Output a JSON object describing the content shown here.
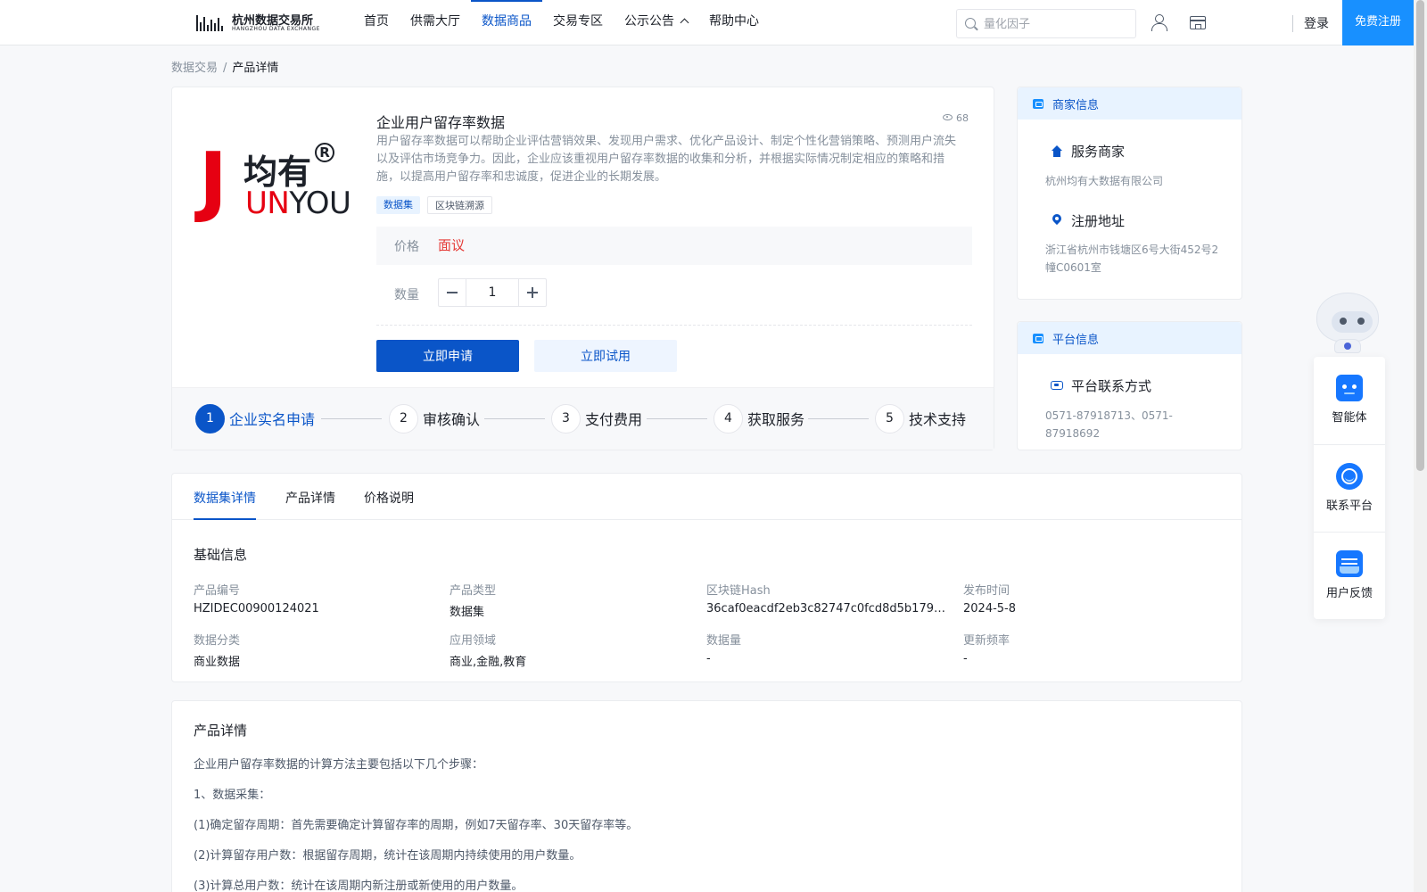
{
  "header": {
    "logo_cn": "杭州数据交易所",
    "logo_en": "HANGZHOU DATA EXCHANGE",
    "nav": [
      {
        "label": "首页",
        "active": false
      },
      {
        "label": "供需大厅",
        "active": false
      },
      {
        "label": "数据商品",
        "active": true
      },
      {
        "label": "交易专区",
        "active": false
      },
      {
        "label": "公示公告",
        "active": false,
        "has_dropdown": true
      },
      {
        "label": "帮助中心",
        "active": false
      }
    ],
    "search_placeholder": "量化因子",
    "login": "登录",
    "register": "免费注册"
  },
  "breadcrumb": {
    "parent": "数据交易",
    "separator": "/",
    "current": "产品详情"
  },
  "product": {
    "logo_j": "J",
    "logo_cn": "均有",
    "logo_reg": "R",
    "logo_en_red": "UN",
    "logo_en_black": "YOU",
    "title": "企业用户留存率数据",
    "views": "68",
    "description": "用户留存率数据可以帮助企业评估营销效果、发现用户需求、优化产品设计、制定个性化营销策略、预测用户流失以及评估市场竞争力。因此，企业应该重视用户留存率数据的收集和分析，并根据实际情况制定相应的策略和措施，以提高用户留存率和忠诚度，促进企业的长期发展。",
    "tags": [
      "数据集",
      "区块链溯源"
    ],
    "price_label": "价格",
    "price_value": "面议",
    "qty_label": "数量",
    "qty_value": "1",
    "apply_button": "立即申请",
    "try_button": "立即试用",
    "steps": [
      {
        "num": "1",
        "label": "企业实名申请",
        "active": true
      },
      {
        "num": "2",
        "label": "审核确认",
        "active": false
      },
      {
        "num": "3",
        "label": "支付费用",
        "active": false
      },
      {
        "num": "4",
        "label": "获取服务",
        "active": false
      },
      {
        "num": "5",
        "label": "技术支持",
        "active": false
      }
    ]
  },
  "merchant": {
    "header": "商家信息",
    "service_label": "服务商家",
    "service_value": "杭州均有大数据有限公司",
    "address_label": "注册地址",
    "address_value": "浙江省杭州市钱塘区6号大街452号2幢C0601室"
  },
  "platform": {
    "header": "平台信息",
    "contact_label": "平台联系方式",
    "contact_value": "0571-87918713、0571-87918692"
  },
  "float_panel": {
    "items": [
      {
        "label": "智能体",
        "icon": "robot-icon"
      },
      {
        "label": "联系平台",
        "icon": "headset-icon"
      },
      {
        "label": "用户反馈",
        "icon": "feedback-icon"
      }
    ]
  },
  "tabs": [
    "数据集详情",
    "产品详情",
    "价格说明"
  ],
  "basic_info": {
    "title": "基础信息",
    "fields": [
      {
        "label": "产品编号",
        "value": "HZIDEC00900124021"
      },
      {
        "label": "产品类型",
        "value": "数据集"
      },
      {
        "label": "区块链Hash",
        "value": "36caf0eacdf2eb3c82747c0fcd8d5b1796d..."
      },
      {
        "label": "发布时间",
        "value": "2024-5-8"
      },
      {
        "label": "数据分类",
        "value": "商业数据"
      },
      {
        "label": "应用领域",
        "value": "商业,金融,教育"
      },
      {
        "label": "数据量",
        "value": "-"
      },
      {
        "label": "更新频率",
        "value": "-"
      }
    ]
  },
  "detail": {
    "title": "产品详情",
    "paragraphs": [
      "企业用户留存率数据的计算方法主要包括以下几个步骤：",
      "1、数据采集：",
      "(1)确定留存周期：首先需要确定计算留存率的周期，例如7天留存率、30天留存率等。",
      "(2)计算留存用户数：根据留存周期，统计在该周期内持续使用的用户数量。",
      "(3)计算总用户数：统计在该周期内新注册或新使用的用户数量。"
    ]
  },
  "colors": {
    "primary": "#0a55c8",
    "register_bg": "#1890ff",
    "price": "#e53935",
    "logo_red": "#e60012"
  }
}
